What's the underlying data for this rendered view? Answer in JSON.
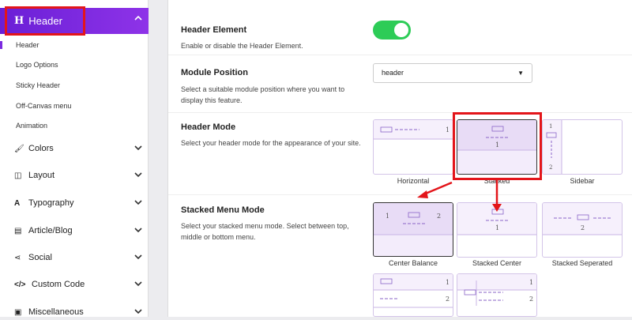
{
  "sidebar": {
    "header": {
      "label": "Header",
      "icon": "h-icon"
    },
    "subitems": [
      "Header",
      "Logo Options",
      "Sticky Header",
      "Off-Canvas menu",
      "Animation"
    ],
    "items": [
      {
        "label": "Colors",
        "icon": "brush-icon"
      },
      {
        "label": "Layout",
        "icon": "layout-icon"
      },
      {
        "label": "Typography",
        "icon": "typography-icon"
      },
      {
        "label": "Article/Blog",
        "icon": "article-icon"
      },
      {
        "label": "Social",
        "icon": "share-icon"
      },
      {
        "label": "Custom Code",
        "icon": "code-icon"
      },
      {
        "label": "Miscellaneous",
        "icon": "misc-icon"
      }
    ]
  },
  "main": {
    "header_element": {
      "title": "Header Element",
      "desc": "Enable or disable the Header Element.",
      "enabled": true
    },
    "module_position": {
      "title": "Module Position",
      "desc": "Select a suitable module position where you want to display this feature.",
      "value": "header"
    },
    "header_mode": {
      "title": "Header Mode",
      "desc": "Select your header mode for the appearance of your site.",
      "options": [
        "Horizontal",
        "Stacked",
        "Sidebar"
      ],
      "selected": "Stacked"
    },
    "stacked_menu_mode": {
      "title": "Stacked Menu Mode",
      "desc": "Select your stacked menu mode. Select between top, middle or bottom menu.",
      "options": [
        "Center Balance",
        "Stacked Center",
        "Stacked Seperated"
      ],
      "selected": "Center Balance"
    }
  },
  "colors": {
    "accent": "#7b2ae0",
    "toggle": "#2dcc57",
    "highlight": "#e3151a"
  }
}
